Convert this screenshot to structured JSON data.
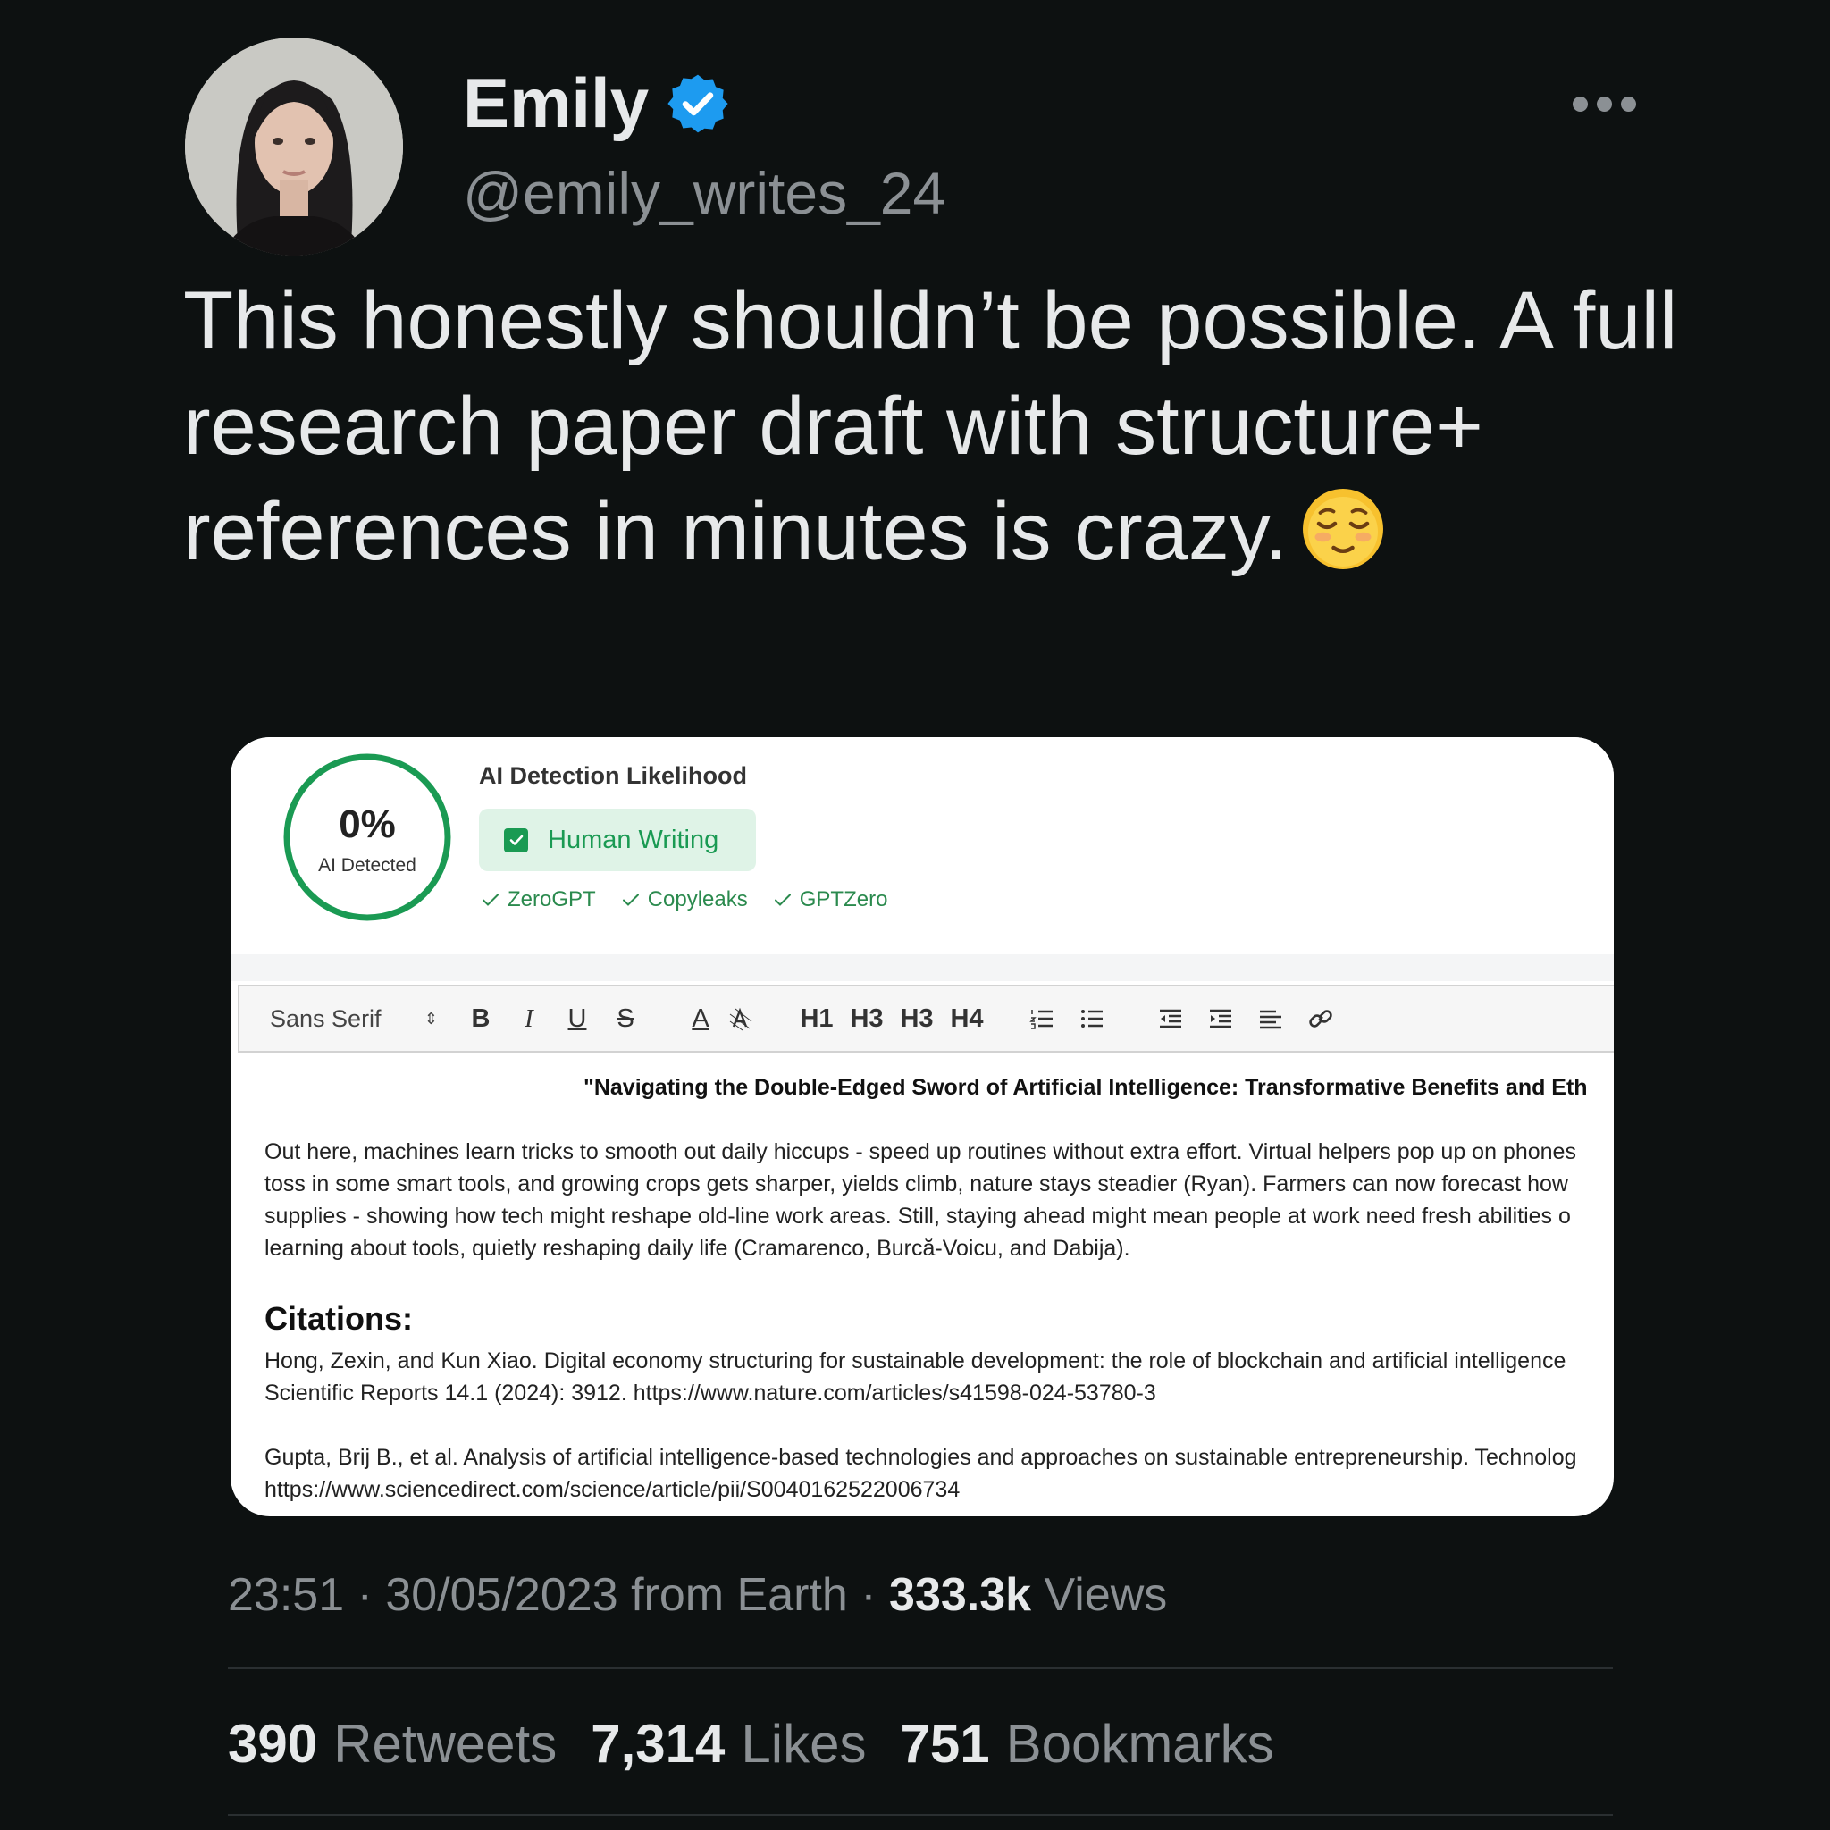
{
  "user": {
    "display_name": "Emily",
    "handle": "@emily_writes_24",
    "verified_icon": "verified-badge-icon"
  },
  "tweet": {
    "text": "This honestly shouldn’t be possible. A full research paper draft with structure+ references in minutes is crazy.",
    "emoji": "relieved-face-emoji"
  },
  "detection": {
    "percent": "0%",
    "percent_label": "AI Detected",
    "title": "AI Detection Likelihood",
    "badge": "Human Writing",
    "detectors": [
      "ZeroGPT",
      "Copyleaks",
      "GPTZero"
    ],
    "accent_color": "#1a9a53"
  },
  "toolbar": {
    "font": "Sans Serif",
    "buttons": [
      "B",
      "I",
      "U",
      "S",
      "A"
    ],
    "headings": [
      "H1",
      "H3",
      "H3",
      "H4"
    ]
  },
  "document": {
    "title": "\"Navigating the Double-Edged Sword of Artificial Intelligence: Transformative Benefits and Eth",
    "paragraph_lines": [
      "Out here, machines learn tricks to smooth out daily hiccups - speed up routines without extra effort. Virtual helpers pop up on phones",
      "toss in some smart tools, and growing crops gets sharper, yields climb, nature stays steadier (Ryan). Farmers can now forecast how",
      "supplies - showing how tech might reshape old-line work areas. Still, staying ahead might mean people at work need fresh abilities o",
      "learning about tools, quietly reshaping daily life (Cramarenco, Burcă-Voicu, and Dabija)."
    ],
    "citations_heading": "Citations:",
    "citations": [
      {
        "line1": "Hong, Zexin, and Kun Xiao. Digital economy structuring for sustainable development: the role of blockchain and artificial intelligence",
        "line2": "Scientific Reports 14.1 (2024): 3912. https://www.nature.com/articles/s41598-024-53780-3"
      },
      {
        "line1": "Gupta, Brij B., et al. Analysis of artificial intelligence-based technologies and approaches on sustainable entrepreneurship. Technolog",
        "line2": "https://www.sciencedirect.com/science/article/pii/S0040162522006734"
      }
    ]
  },
  "meta": {
    "time": "23:51",
    "date": "30/05/2023",
    "source": "from Earth",
    "views_count": "333.3k",
    "views_label": "Views"
  },
  "stats": {
    "retweets_count": "390",
    "retweets_label": "Retweets",
    "likes_count": "7,314",
    "likes_label": "Likes",
    "bookmarks_count": "751",
    "bookmarks_label": "Bookmarks"
  },
  "colors": {
    "background": "#0d1111",
    "verified": "#1d9bf0"
  }
}
